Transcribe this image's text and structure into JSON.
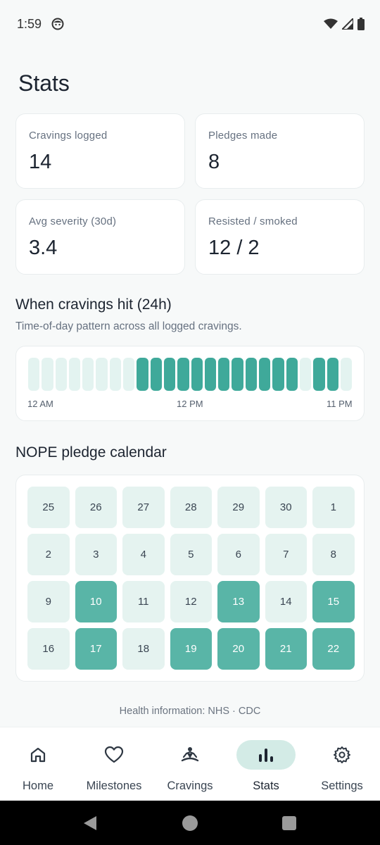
{
  "status_bar": {
    "time": "1:59",
    "app_icon": "face-icon",
    "wifi_icon": "wifi-icon",
    "signal_icon": "signal-icon",
    "battery_icon": "battery-icon"
  },
  "page": {
    "title": "Stats"
  },
  "stats": [
    {
      "label": "Cravings logged",
      "value": "14"
    },
    {
      "label": "Pledges made",
      "value": "8"
    },
    {
      "label": "Avg severity (30d)",
      "value": "3.4"
    },
    {
      "label": "Resisted / smoked",
      "value": "12 / 2"
    }
  ],
  "cravings_chart": {
    "title": "When cravings hit (24h)",
    "subtitle": "Time-of-day pattern across all logged cravings.",
    "hours": [
      0,
      0,
      0,
      0,
      0,
      0,
      0,
      0,
      1,
      1,
      1,
      1,
      1,
      1,
      1,
      1,
      1,
      1,
      1,
      1,
      0,
      1,
      1,
      0
    ],
    "axis": {
      "start": "12 AM",
      "mid": "12 PM",
      "end": "11 PM"
    },
    "colors": {
      "high": "#3fa99a",
      "low": "#e3f3f0"
    }
  },
  "calendar": {
    "title": "NOPE pledge calendar",
    "days": [
      {
        "day": "25",
        "pledged": false
      },
      {
        "day": "26",
        "pledged": false
      },
      {
        "day": "27",
        "pledged": false
      },
      {
        "day": "28",
        "pledged": false
      },
      {
        "day": "29",
        "pledged": false
      },
      {
        "day": "30",
        "pledged": false
      },
      {
        "day": "1",
        "pledged": false
      },
      {
        "day": "2",
        "pledged": false
      },
      {
        "day": "3",
        "pledged": false
      },
      {
        "day": "4",
        "pledged": false
      },
      {
        "day": "5",
        "pledged": false
      },
      {
        "day": "6",
        "pledged": false
      },
      {
        "day": "7",
        "pledged": false
      },
      {
        "day": "8",
        "pledged": false
      },
      {
        "day": "9",
        "pledged": false
      },
      {
        "day": "10",
        "pledged": true
      },
      {
        "day": "11",
        "pledged": false
      },
      {
        "day": "12",
        "pledged": false
      },
      {
        "day": "13",
        "pledged": true
      },
      {
        "day": "14",
        "pledged": false
      },
      {
        "day": "15",
        "pledged": true
      },
      {
        "day": "16",
        "pledged": false
      },
      {
        "day": "17",
        "pledged": true
      },
      {
        "day": "18",
        "pledged": false
      },
      {
        "day": "19",
        "pledged": true
      },
      {
        "day": "20",
        "pledged": true
      },
      {
        "day": "21",
        "pledged": true
      },
      {
        "day": "22",
        "pledged": true
      }
    ],
    "colors": {
      "pledged": "#59b5a7",
      "empty": "#e5f3f0"
    }
  },
  "footer": {
    "note": "Health information: NHS · CDC"
  },
  "nav": [
    {
      "label": "Home",
      "icon": "home-icon",
      "active": false
    },
    {
      "label": "Milestones",
      "icon": "heart-icon",
      "active": false
    },
    {
      "label": "Cravings",
      "icon": "meditation-icon",
      "active": false
    },
    {
      "label": "Stats",
      "icon": "bar-chart-icon",
      "active": true
    },
    {
      "label": "Settings",
      "icon": "gear-icon",
      "active": false
    }
  ],
  "system_nav": {
    "back": "back-icon",
    "home": "home-circle-icon",
    "recents": "recents-icon"
  },
  "accent_color": "#3fa99a"
}
